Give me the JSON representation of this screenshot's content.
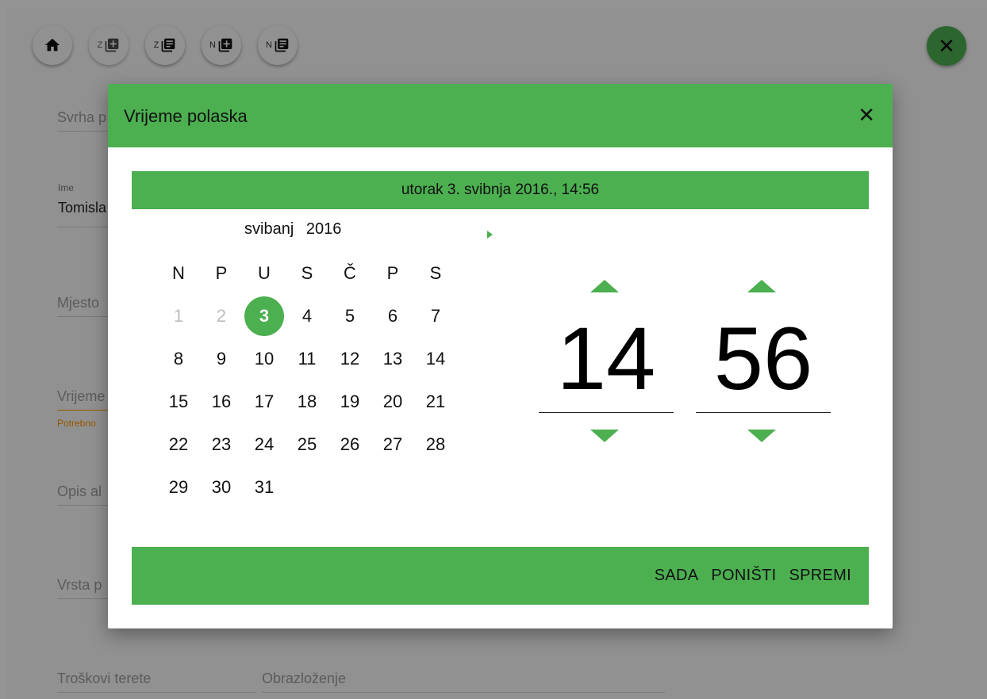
{
  "toolbar": {
    "home_icon": "home-icon",
    "buttons": [
      {
        "prefix": "Z",
        "icon": "library-add-icon"
      },
      {
        "prefix": "Z",
        "icon": "library-books-icon"
      },
      {
        "prefix": "N",
        "icon": "library-add-icon"
      },
      {
        "prefix": "N",
        "icon": "library-books-icon"
      }
    ],
    "close_glyph": "✕"
  },
  "form": {
    "purpose_placeholder": "Svrha p",
    "name_label": "Ime",
    "name_value": "Tomisla",
    "place_placeholder": "Mjesto",
    "time_placeholder": "Vrijeme",
    "time_error": "Potrebno",
    "description_placeholder": "Opis al",
    "type_placeholder": "Vrsta p",
    "costs_placeholder": "Troškovi terete",
    "justification_placeholder": "Obrazloženje"
  },
  "dialog": {
    "title": "Vrijeme polaska",
    "close_glyph": "✕",
    "selected_datetime": "utorak 3. svibnja 2016., 14:56",
    "month": "svibanj",
    "year": "2016",
    "weekdays": [
      "N",
      "P",
      "U",
      "S",
      "Č",
      "P",
      "S"
    ],
    "weeks": [
      [
        "1",
        "2",
        "3",
        "4",
        "5",
        "6",
        "7"
      ],
      [
        "8",
        "9",
        "10",
        "11",
        "12",
        "13",
        "14"
      ],
      [
        "15",
        "16",
        "17",
        "18",
        "19",
        "20",
        "21"
      ],
      [
        "22",
        "23",
        "24",
        "25",
        "26",
        "27",
        "28"
      ],
      [
        "29",
        "30",
        "31",
        "",
        "",
        "",
        ""
      ]
    ],
    "hour": "14",
    "minute": "56",
    "footer": {
      "now_label": "SADA",
      "cancel_label": "PONIŠTI",
      "save_label": "SPREMI"
    }
  },
  "colors": {
    "accent": "#4caf50",
    "muted_day": "#bdbdbd",
    "error": "#ff9800"
  }
}
